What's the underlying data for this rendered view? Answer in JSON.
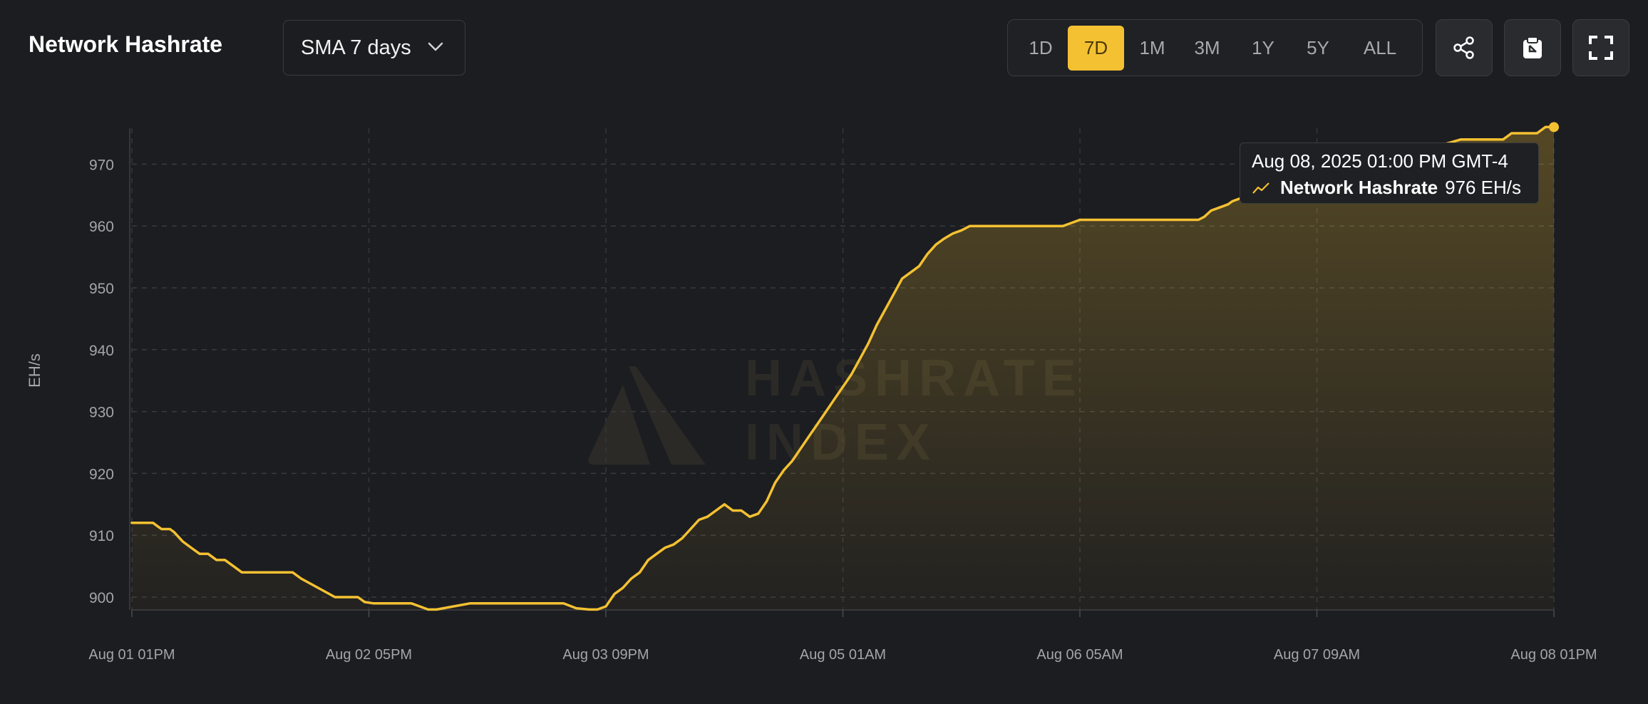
{
  "header": {
    "title": "Network Hashrate",
    "select": {
      "value": "SMA 7 days",
      "icon": "chevron-down-icon"
    },
    "ranges": [
      "1D",
      "7D",
      "1M",
      "3M",
      "1Y",
      "5Y",
      "ALL"
    ],
    "active_range": "7D",
    "actions": [
      {
        "name": "share",
        "icon": "share-icon"
      },
      {
        "name": "copy",
        "icon": "clipboard-icon"
      },
      {
        "name": "fullscreen",
        "icon": "fullscreen-icon"
      }
    ]
  },
  "tooltip": {
    "time": "Aug 08, 2025 01:00 PM GMT-4",
    "series": "Network Hashrate",
    "value": "976 EH/s",
    "icon": "line-chart-icon"
  },
  "watermark": {
    "line1": "HASHRATE",
    "line2": "INDEX"
  },
  "colors": {
    "line": "#f4c132",
    "background": "#1c1d20",
    "active": "#f4c132"
  },
  "chart_data": {
    "type": "area",
    "ylabel": "EH/s",
    "ylim": [
      898,
      976
    ],
    "yticks": [
      900,
      910,
      920,
      930,
      940,
      950,
      960,
      970
    ],
    "xlim": [
      0,
      168
    ],
    "xticks": [
      {
        "label": "Aug 01 01PM",
        "hour": 0
      },
      {
        "label": "Aug 02 05PM",
        "hour": 28
      },
      {
        "label": "Aug 03 09PM",
        "hour": 56
      },
      {
        "label": "Aug 05 01AM",
        "hour": 84
      },
      {
        "label": "Aug 06 05AM",
        "hour": 112
      },
      {
        "label": "Aug 07 09AM",
        "hour": 140
      },
      {
        "label": "Aug 08 01PM",
        "hour": 168
      }
    ],
    "grid": true,
    "series": [
      {
        "name": "Network Hashrate",
        "x": [
          0,
          1.5,
          2.5,
          3,
          3.5,
          4,
          4.5,
          5,
          6,
          7,
          8,
          9,
          10,
          11,
          12,
          13,
          14,
          15,
          16,
          18,
          19,
          20,
          22,
          24,
          26,
          26.7,
          27.5,
          28.5,
          29.5,
          31,
          32,
          33,
          34,
          35,
          36,
          38,
          40,
          42,
          45,
          46.5,
          47.5,
          49,
          51,
          52.5,
          54,
          55,
          56,
          57,
          58,
          59,
          60,
          61,
          62,
          63,
          64,
          65,
          66,
          67,
          68,
          69,
          70,
          71,
          72,
          73,
          74,
          75,
          76,
          77,
          78,
          79,
          80,
          81,
          82,
          83,
          84,
          85,
          86,
          87,
          88,
          89,
          90,
          91,
          92,
          93,
          94,
          95,
          96,
          97,
          98,
          99,
          100,
          101,
          102,
          103,
          104,
          105,
          106,
          107,
          108,
          109,
          110,
          111,
          112,
          113,
          120,
          126,
          126.7,
          127.5,
          128.5,
          129.5,
          130,
          131,
          132,
          133,
          134,
          135,
          136,
          138,
          140,
          147,
          157,
          158,
          162,
          163,
          166,
          167,
          168
        ],
        "y": [
          912,
          912,
          912,
          911.5,
          911,
          911,
          911,
          910.5,
          909,
          908,
          907,
          907,
          906,
          906,
          905,
          904,
          904,
          904,
          904,
          904,
          904,
          903,
          901.5,
          900,
          900,
          900,
          899.2,
          899,
          899,
          899,
          899,
          899,
          898.5,
          898,
          898,
          898.5,
          899,
          899,
          899,
          899,
          899,
          899,
          899,
          898.2,
          898,
          898,
          898.5,
          900.5,
          901.5,
          903,
          904,
          906,
          907,
          908,
          908.5,
          909.5,
          911,
          912.5,
          913,
          914,
          915,
          914,
          914,
          913,
          913.5,
          915.5,
          918.5,
          920.5,
          922,
          924,
          926,
          928,
          930,
          932,
          934,
          936,
          938.5,
          941,
          944,
          946.5,
          949,
          951.5,
          952.5,
          953.5,
          955.5,
          957,
          958,
          958.8,
          959.3,
          960,
          960,
          960,
          960,
          960,
          960,
          960,
          960,
          960,
          960,
          960,
          960,
          960.5,
          961,
          961,
          961,
          961,
          961.5,
          962.5,
          963,
          963.5,
          964,
          964.5,
          965,
          966,
          966.5,
          967,
          967.5,
          968,
          968,
          970,
          974,
          974,
          974,
          975,
          975,
          976,
          976
        ]
      }
    ]
  }
}
